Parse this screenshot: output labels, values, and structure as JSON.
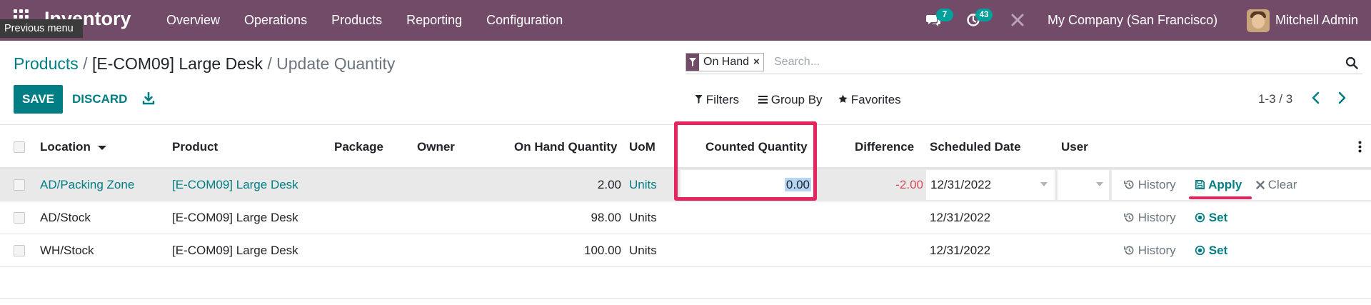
{
  "navbar": {
    "app_name": "Inventory",
    "menu": [
      "Overview",
      "Operations",
      "Products",
      "Reporting",
      "Configuration"
    ],
    "tooltip": "Previous menu",
    "messages_count": "7",
    "activities_count": "43",
    "company": "My Company (San Francisco)",
    "user": "Mitchell Admin"
  },
  "breadcrumb": {
    "root": "Products",
    "separator": "/",
    "record": "[E-COM09] Large Desk",
    "current": "Update Quantity"
  },
  "actions": {
    "save_label": "SAVE",
    "discard_label": "DISCARD"
  },
  "search": {
    "facet_label": "On Hand",
    "facet_remove": "×",
    "placeholder": "Search...",
    "filters_label": "Filters",
    "groupby_label": "Group By",
    "favorites_label": "Favorites"
  },
  "pager": {
    "text": "1-3 / 3"
  },
  "table": {
    "columns": {
      "location": "Location",
      "product": "Product",
      "package": "Package",
      "owner": "Owner",
      "on_hand": "On Hand Quantity",
      "uom": "UoM",
      "counted": "Counted Quantity",
      "difference": "Difference",
      "scheduled_date": "Scheduled Date",
      "user": "User"
    },
    "rows": [
      {
        "location": "AD/Packing Zone",
        "product": "[E-COM09] Large Desk",
        "on_hand": "2.00",
        "uom": "Units",
        "counted": "0.00",
        "difference": "-2.00",
        "scheduled_date": "12/31/2022",
        "history": "History",
        "primary": "Apply",
        "clear": "Clear"
      },
      {
        "location": "AD/Stock",
        "product": "[E-COM09] Large Desk",
        "on_hand": "98.00",
        "uom": "Units",
        "scheduled_date": "12/31/2022",
        "history": "History",
        "primary": "Set"
      },
      {
        "location": "WH/Stock",
        "product": "[E-COM09] Large Desk",
        "on_hand": "100.00",
        "uom": "Units",
        "scheduled_date": "12/31/2022",
        "history": "History",
        "primary": "Set"
      }
    ]
  },
  "colors": {
    "navbar": "#714b67",
    "primary": "#017e84",
    "badge": "#00a09d",
    "highlight": "#e8245f",
    "negative": "#d44c59"
  },
  "icons": {
    "apps": "apps-grid-icon",
    "chat": "chat-icon",
    "activity": "clock-icon",
    "debug": "tools-icon",
    "download": "download-icon",
    "filter": "filter-icon",
    "groupby": "list-icon",
    "favorites": "star-icon",
    "search": "search-icon",
    "history": "history-icon",
    "apply": "save-icon",
    "set": "target-icon",
    "clear": "close-icon"
  }
}
